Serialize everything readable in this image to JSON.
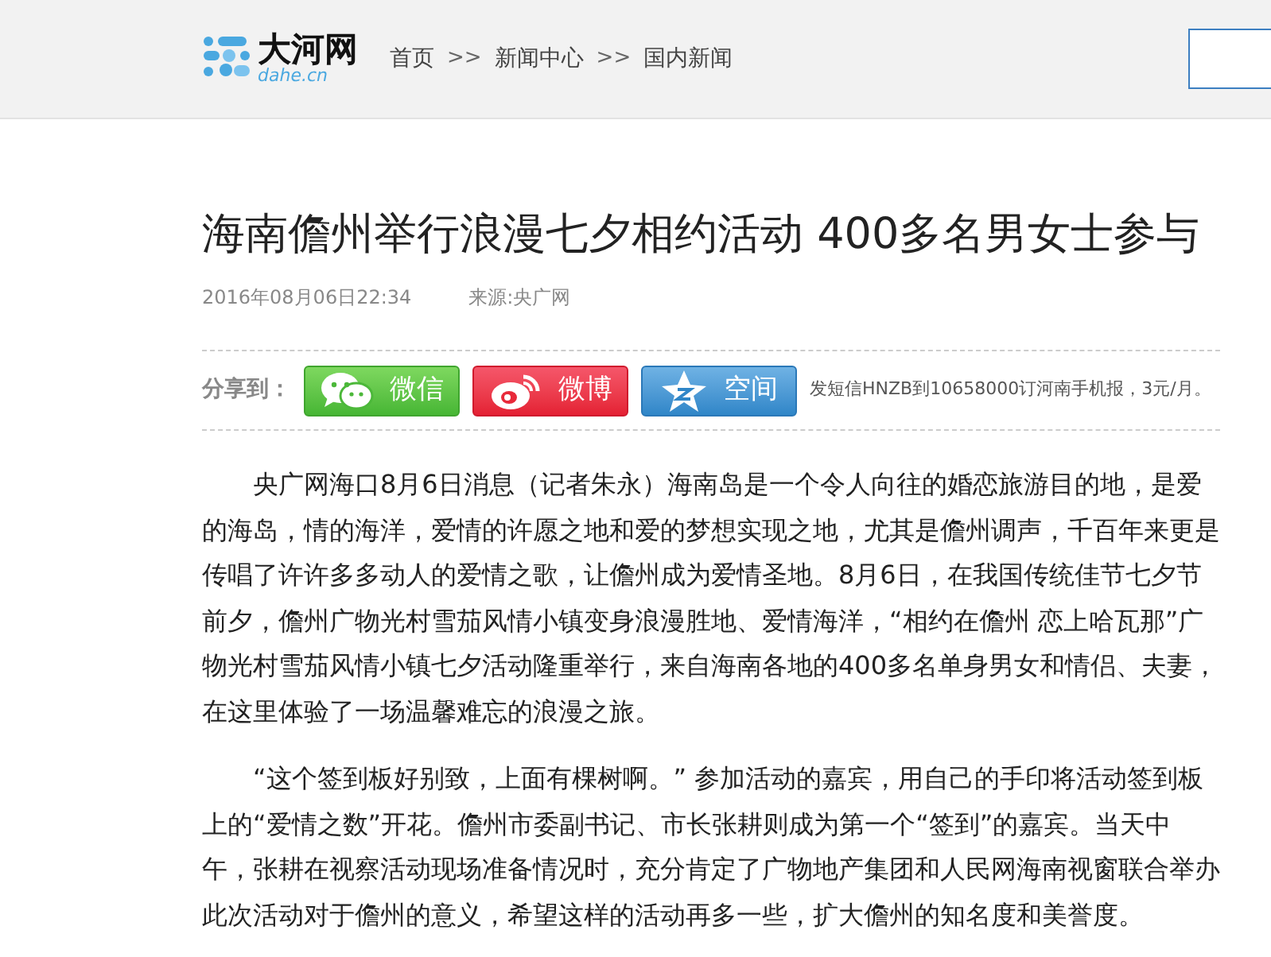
{
  "header": {
    "logo": {
      "name": "大河网",
      "domain": "dahe.cn"
    },
    "breadcrumb": [
      {
        "label": "首页"
      },
      {
        "label": "新闻中心"
      },
      {
        "label": "国内新闻"
      }
    ],
    "separator": ">>"
  },
  "article": {
    "title": "海南儋州举行浪漫七夕相约活动 400多名男女士参与",
    "date": "2016年08月06日22:34",
    "source": "来源:央广网",
    "share": {
      "label": "分享到：",
      "buttons": [
        {
          "label": "微信",
          "kind": "wechat"
        },
        {
          "label": "微博",
          "kind": "weibo"
        },
        {
          "label": "空间",
          "kind": "qzone"
        }
      ],
      "note": "发短信HNZB到10658000订河南手机报，3元/月。"
    },
    "paragraphs": [
      "央广网海口8月6日消息（记者朱永）海南岛是一个令人向往的婚恋旅游目的地，是爱的海岛，情的海洋，爱情的许愿之地和爱的梦想实现之地，尤其是儋州调声，千百年来更是传唱了许许多多动人的爱情之歌，让儋州成为爱情圣地。8月6日，在我国传统佳节七夕节前夕，儋州广物光村雪茄风情小镇变身浪漫胜地、爱情海洋，“相约在儋州 恋上哈瓦那”广物光村雪茄风情小镇七夕活动隆重举行，来自海南各地的400多名单身男女和情侣、夫妻，在这里体验了一场温馨难忘的浪漫之旅。",
      "“这个签到板好别致，上面有棵树啊。” 参加活动的嘉宾，用自己的手印将活动签到板上的“爱情之数”开花。儋州市委副书记、市长张耕则成为第一个“签到”的嘉宾。当天中午，张耕在视察活动现场准备情况时，充分肯定了广物地产集团和人民网海南视窗联合举办此次活动对于儋州的意义，希望这样的活动再多一些，扩大儋州的知名度和美誉度。"
    ]
  }
}
